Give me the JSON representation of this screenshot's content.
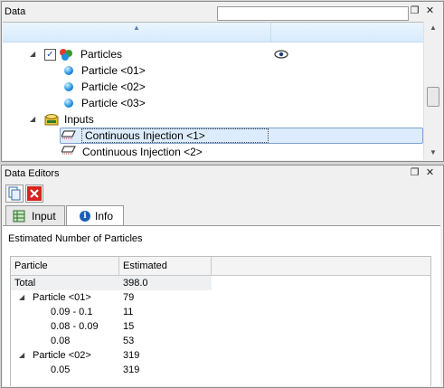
{
  "data_panel": {
    "title": "Data",
    "tree": {
      "particles_label": "Particles",
      "particle_items": [
        "Particle <01>",
        "Particle <02>",
        "Particle <03>"
      ],
      "inputs_label": "Inputs",
      "input_items": [
        "Continuous Injection <1>",
        "Continuous Injection <2>"
      ]
    }
  },
  "editors_panel": {
    "title": "Data Editors",
    "tabs": [
      {
        "label": "Input"
      },
      {
        "label": "Info"
      }
    ],
    "info": {
      "heading": "Estimated Number of Particles",
      "columns": [
        "Particle",
        "Estimated"
      ],
      "rows": [
        {
          "name": "Total",
          "value": "398.0"
        },
        {
          "name": "Particle <01>",
          "value": "79"
        },
        {
          "name": "0.09 - 0.1",
          "value": "11"
        },
        {
          "name": "0.08 - 0.09",
          "value": "15"
        },
        {
          "name": "0.08",
          "value": "53"
        },
        {
          "name": "Particle <02>",
          "value": "319"
        },
        {
          "name": "0.05",
          "value": "319"
        }
      ]
    }
  },
  "icons": {
    "restore": "restore-window-icon",
    "close": "close-icon",
    "visibility": "eye-icon",
    "copy": "copy-icon",
    "delete": "delete-x-icon"
  },
  "colors": {
    "selection": "#cce8ff",
    "delete_red": "#d9231b",
    "particle_blue": "#1e90e0"
  }
}
